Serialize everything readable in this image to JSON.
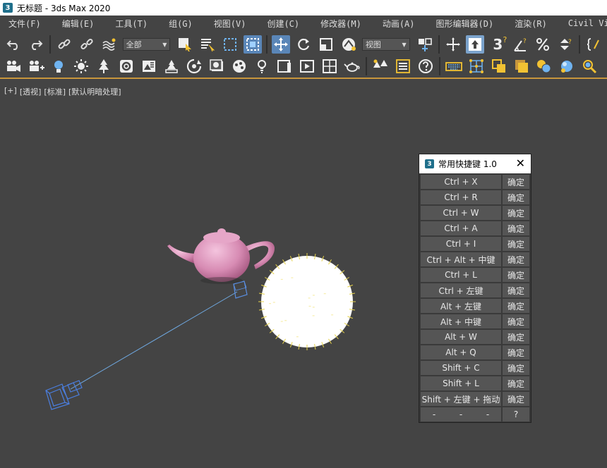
{
  "window": {
    "app_badge": "3",
    "title": "无标题 - 3ds Max 2020"
  },
  "menu": {
    "items": [
      "文件(F)",
      "编辑(E)",
      "工具(T)",
      "组(G)",
      "视图(V)",
      "创建(C)",
      "修改器(M)",
      "动画(A)",
      "图形编辑器(D)",
      "渲染(R)",
      "Civil View"
    ]
  },
  "toolbar1": {
    "selection_filter": "全部",
    "coord_system": "视图",
    "snap_label": "3",
    "snap_sup": "?"
  },
  "toolbar2": {},
  "viewport": {
    "labels": [
      "[+]",
      "[透视]",
      "[标准]",
      "[默认明暗处理]"
    ]
  },
  "dialog": {
    "badge": "3",
    "title": "常用快捷键 1.0",
    "close": "✕",
    "ok_label": "确定",
    "shortcuts": [
      "Ctrl + X",
      "Ctrl + R",
      "Ctrl + W",
      "Ctrl + A",
      "Ctrl + I",
      "Ctrl + Alt + 中键",
      "Ctrl + L",
      "Ctrl + 左键",
      "Alt + 左键",
      "Alt + 中键",
      "Alt + W",
      "Alt + Q",
      "Shift + C",
      "Shift + L",
      "Shift + 左键 + 拖动"
    ],
    "last_row": [
      "-",
      "-",
      "-",
      "?"
    ]
  }
}
